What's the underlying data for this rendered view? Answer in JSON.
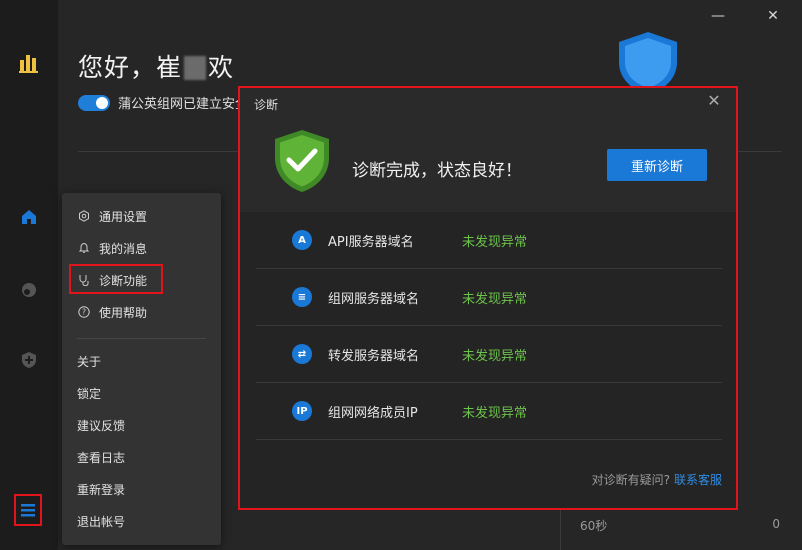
{
  "window": {
    "minimize_symbol": "—",
    "close_symbol": "✕"
  },
  "greeting": {
    "text_prefix": "您好，崔",
    "text_suffix": "欢"
  },
  "status_line": {
    "text": "蒲公英组网已建立安全"
  },
  "footer": {
    "left": "60秒",
    "right": "0"
  },
  "menu": {
    "items_icon": [
      {
        "label": "通用设置",
        "icon": "settings-icon"
      },
      {
        "label": "我的消息",
        "icon": "bell-icon"
      },
      {
        "label": "诊断功能",
        "icon": "stethoscope-icon"
      },
      {
        "label": "使用帮助",
        "icon": "help-icon"
      }
    ],
    "items_plain": [
      "关于",
      "锁定",
      "建议反馈",
      "查看日志",
      "重新登录",
      "退出帐号"
    ]
  },
  "dialog": {
    "title": "诊断",
    "close_symbol": "✕",
    "message": "诊断完成，状态良好！",
    "rediagnose_label": "重新诊断",
    "rows": [
      {
        "icon_text": "A",
        "name": "API服务器域名",
        "status": "未发现异常"
      },
      {
        "icon_text": "≡",
        "name": "组网服务器域名",
        "status": "未发现异常"
      },
      {
        "icon_text": "⇄",
        "name": "转发服务器域名",
        "status": "未发现异常"
      },
      {
        "icon_text": "IP",
        "name": "组网网络成员IP",
        "status": "未发现异常"
      }
    ],
    "help_question": "对诊断有疑问?",
    "help_link": "联系客服"
  },
  "colors": {
    "accent": "#1a78d6",
    "ok_green": "#6cc24a",
    "highlight_red": "#e0141a",
    "shield_green": "#5fb336"
  }
}
